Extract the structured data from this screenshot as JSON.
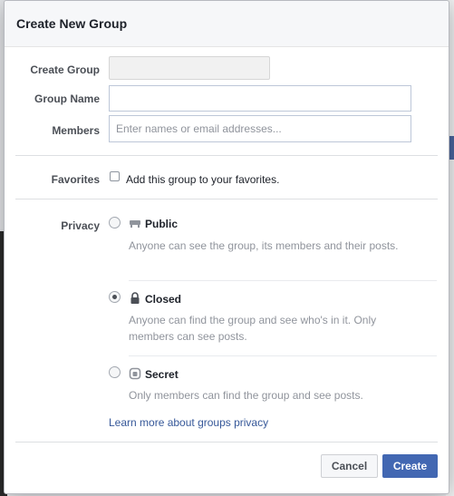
{
  "dialog": {
    "title": "Create New Group"
  },
  "form": {
    "create_group_label": "Create Group",
    "group_name_label": "Group Name",
    "group_name_value": "",
    "members_label": "Members",
    "members_placeholder": "Enter names or email addresses...",
    "favorites_label": "Favorites",
    "favorites_text": "Add this group to your favorites.",
    "favorites_checked": false
  },
  "privacy": {
    "label": "Privacy",
    "selected": "Closed",
    "options": [
      {
        "title": "Public",
        "icon": "globe-icon",
        "description": "Anyone can see the group, its members and their posts."
      },
      {
        "title": "Closed",
        "icon": "lock-icon",
        "description": "Anyone can find the group and see who's in it. Only members can see posts."
      },
      {
        "title": "Secret",
        "icon": "shield-icon",
        "description": "Only members can find the group and see posts."
      }
    ],
    "learn_more": "Learn more about groups privacy"
  },
  "footer": {
    "cancel_label": "Cancel",
    "create_label": "Create"
  },
  "colors": {
    "accent": "#4267b2",
    "link": "#365899",
    "header_bg": "#f6f7f9"
  }
}
